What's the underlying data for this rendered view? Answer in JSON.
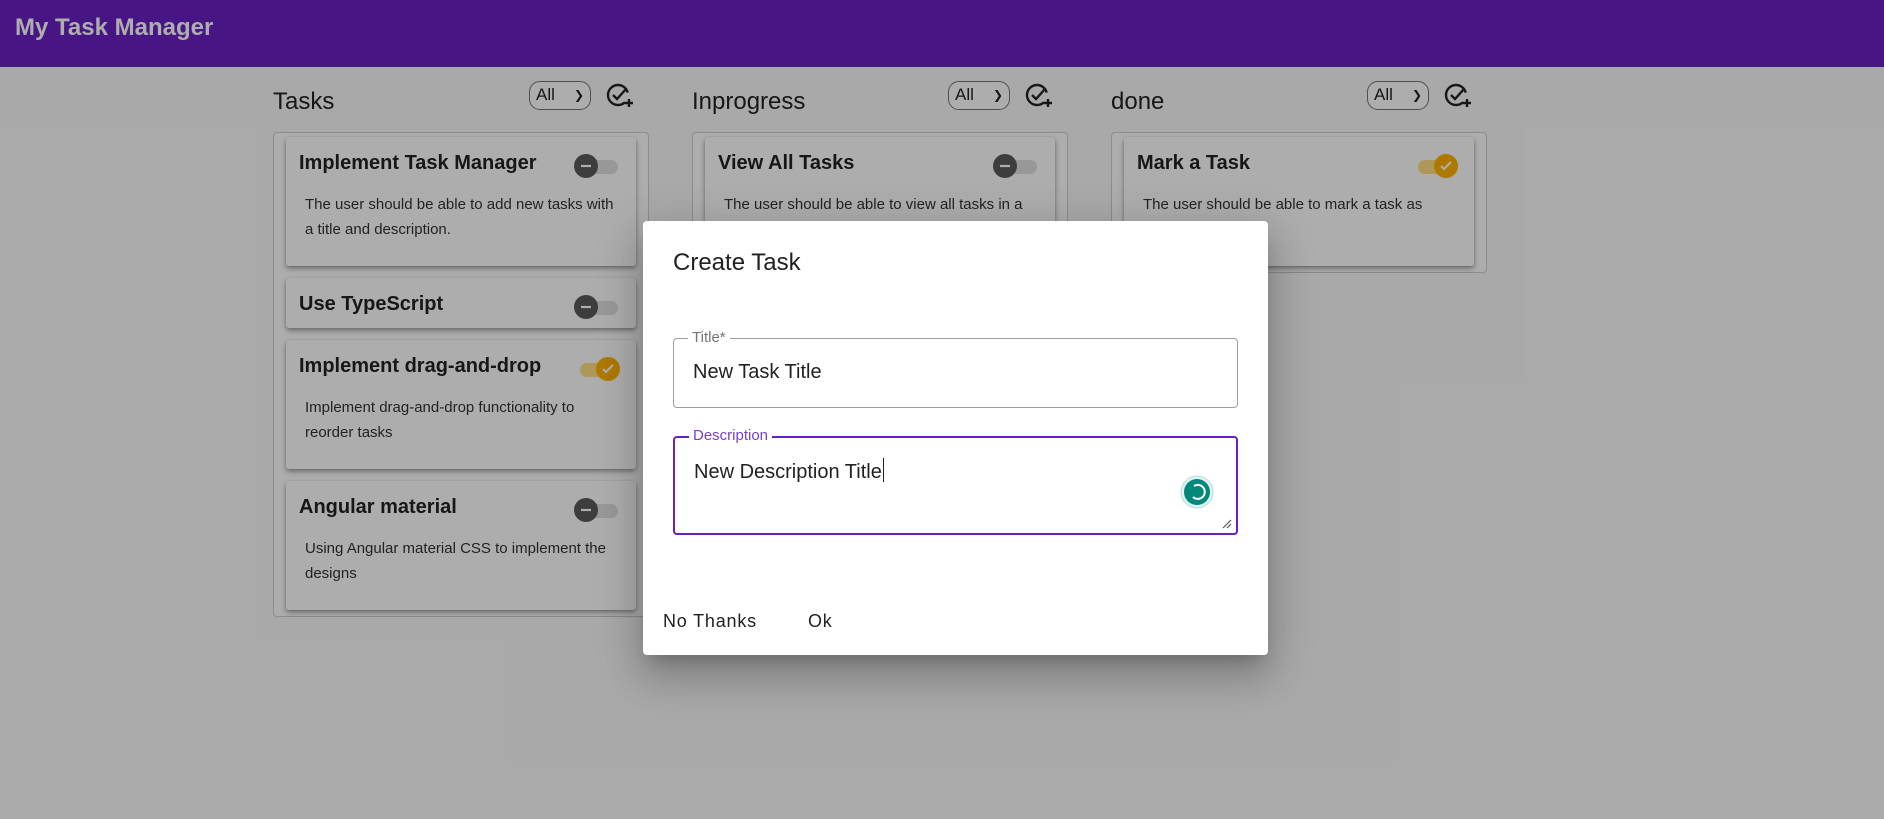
{
  "app": {
    "title": "My Task Manager",
    "brand_color": "#6a1fc5",
    "accent_color": "#ffb300"
  },
  "columns": [
    {
      "title": "Tasks",
      "filter_value": "All",
      "add_icon": "add-task-icon",
      "cards": [
        {
          "title": "Implement Task Manager",
          "description": "The user should be able to add new tasks with a title and description.",
          "done": false
        },
        {
          "title": "Use TypeScript",
          "description": "",
          "done": false
        },
        {
          "title": "Implement drag-and-drop",
          "description": "Implement drag-and-drop functionality to reorder tasks",
          "done": true
        },
        {
          "title": "Angular material",
          "description": "Using Angular material CSS to implement the designs",
          "done": false
        }
      ]
    },
    {
      "title": "Inprogress",
      "filter_value": "All",
      "add_icon": "add-task-icon",
      "cards": [
        {
          "title": "View All Tasks",
          "description": "The user should be able to view all tasks in a",
          "done": false
        }
      ]
    },
    {
      "title": "done",
      "filter_value": "All",
      "add_icon": "add-task-icon",
      "cards": [
        {
          "title": "Mark a Task",
          "description": "The user should be able to mark a task as",
          "done": true
        }
      ]
    }
  ],
  "dialog": {
    "title": "Create Task",
    "title_field": {
      "label": "Title*",
      "value": "New Task Title"
    },
    "description_field": {
      "label": "Description",
      "value": "New Description Title"
    },
    "cancel_label": "No Thanks",
    "ok_label": "Ok"
  }
}
